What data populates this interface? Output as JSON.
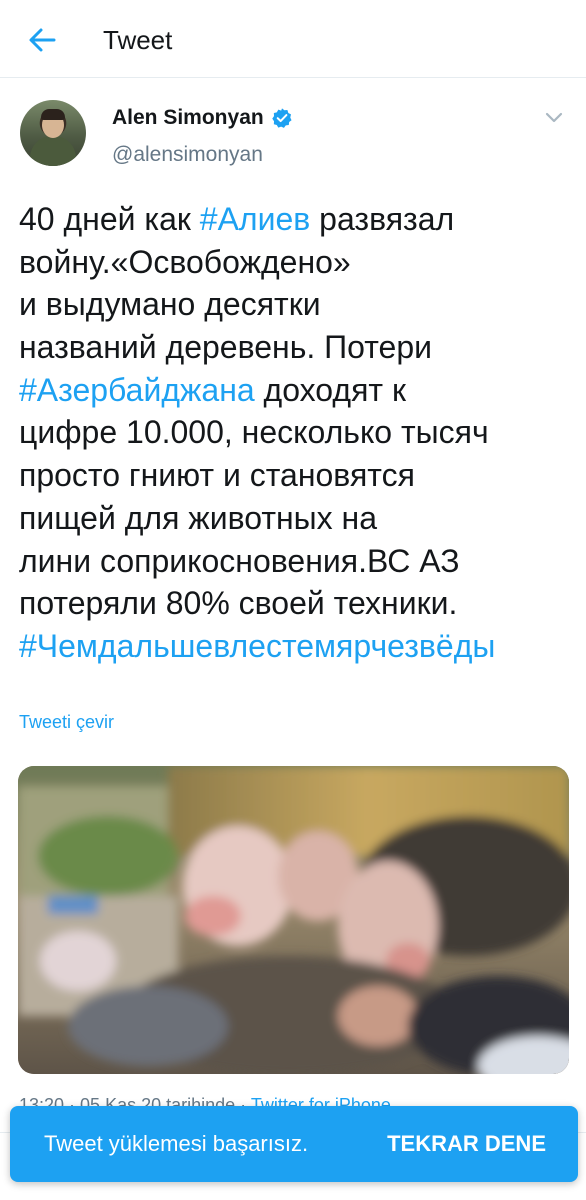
{
  "header": {
    "title": "Tweet",
    "back_icon": "arrow-left-icon"
  },
  "tweet": {
    "author_name": "Alen Simonyan",
    "author_handle": "@alensimonyan",
    "verified": true,
    "text_lines": [
      [
        {
          "t": "40 дней как ",
          "h": false
        },
        {
          "t": "#Алиев",
          "h": true
        },
        {
          "t": " развязал",
          "h": false
        }
      ],
      [
        {
          "t": "войну.«Освобождено»",
          "h": false
        }
      ],
      [
        {
          "t": "и выдумано десятки",
          "h": false
        }
      ],
      [
        {
          "t": "названий деревень. Потери",
          "h": false
        }
      ],
      [
        {
          "t": "#Азербайджана",
          "h": true
        },
        {
          "t": " доходят к",
          "h": false
        }
      ],
      [
        {
          "t": "цифре 10.000, несколько тысяч",
          "h": false
        }
      ],
      [
        {
          "t": "просто гниют и становятся",
          "h": false
        }
      ],
      [
        {
          "t": "пищей для животных на",
          "h": false
        }
      ],
      [
        {
          "t": "лини соприкосновения.ВС АЗ",
          "h": false
        }
      ],
      [
        {
          "t": "потеряли 80% своей техники.",
          "h": false
        }
      ],
      [
        {
          "t": "#Чемдальшевлестемярчезвёды",
          "h": true
        }
      ]
    ],
    "translate_label": "Tweeti çevir",
    "timestamp": "13:20 · 05 Kas 20 tarihinde · ",
    "source": "Twitter for iPhone"
  },
  "toast": {
    "message": "Tweet yüklemesi başarısız.",
    "action": "TEKRAR DENE"
  },
  "colors": {
    "accent": "#1da1f2",
    "text": "#14171a",
    "secondary": "#657786",
    "divider": "#e6ecf0"
  }
}
